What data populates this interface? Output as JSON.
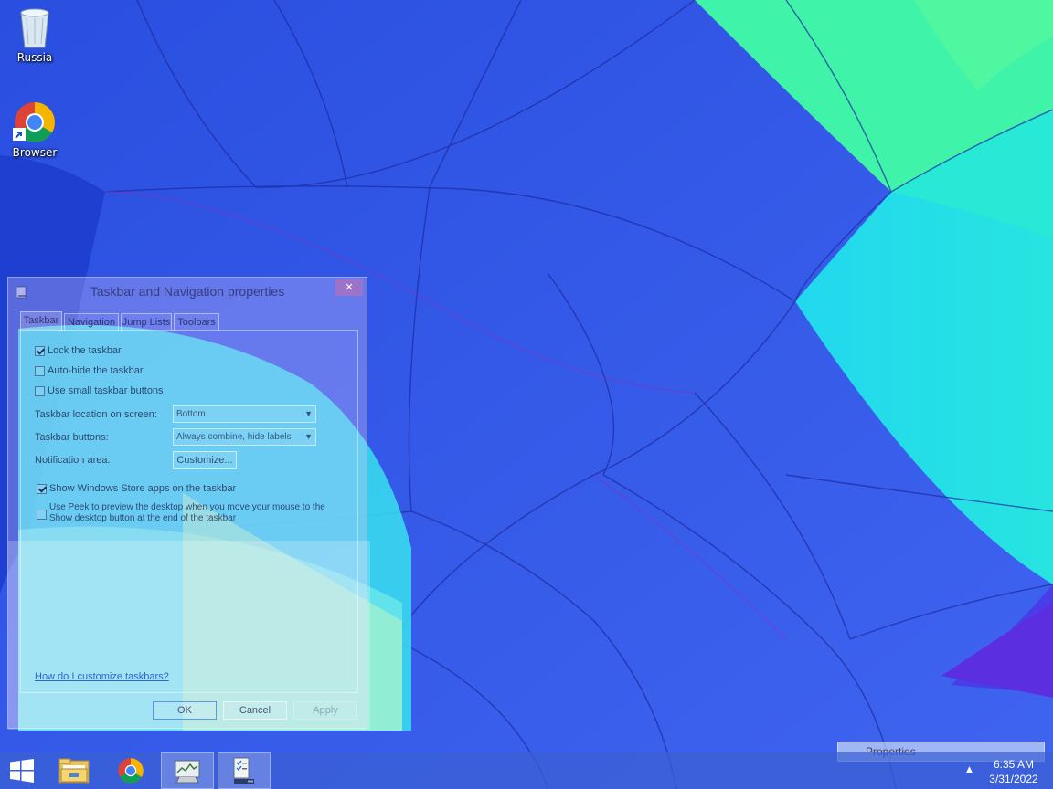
{
  "desktop": {
    "icons": [
      {
        "label": "Russia",
        "icon": "recycle-bin-icon"
      },
      {
        "label": "Browser",
        "icon": "chrome-icon"
      }
    ]
  },
  "dialog": {
    "title": "Taskbar and Navigation properties",
    "close_glyph": "✕",
    "tabs": [
      {
        "label": "Taskbar",
        "active": true
      },
      {
        "label": "Navigation",
        "active": false
      },
      {
        "label": "Jump Lists",
        "active": false
      },
      {
        "label": "Toolbars",
        "active": false
      }
    ],
    "options": {
      "lock_taskbar": {
        "label": "Lock the taskbar",
        "checked": true
      },
      "auto_hide": {
        "label": "Auto-hide the taskbar",
        "checked": false
      },
      "small_buttons": {
        "label": "Use small taskbar buttons",
        "checked": false
      },
      "location_label": "Taskbar location on screen:",
      "location_value": "Bottom",
      "buttons_label": "Taskbar buttons:",
      "buttons_value": "Always combine, hide labels",
      "notification_label": "Notification area:",
      "customize_button": "Customize...",
      "store_apps": {
        "label": "Show Windows Store apps on the taskbar",
        "checked": true
      },
      "peek": {
        "label_line1": "Use Peek to preview the desktop when you move your mouse to the",
        "label_line2": "Show desktop button at the end of the taskbar",
        "checked": false
      }
    },
    "help_link": "How do I customize taskbars?",
    "buttons": {
      "ok": "OK",
      "cancel": "Cancel",
      "apply": "Apply"
    }
  },
  "taskbar": {
    "items": [
      {
        "name": "start-button",
        "icon": "windows-logo-icon"
      },
      {
        "name": "file-explorer",
        "icon": "folder-icon"
      },
      {
        "name": "chrome",
        "icon": "chrome-icon"
      },
      {
        "name": "system-monitor",
        "icon": "monitor-chart-icon"
      },
      {
        "name": "properties-window",
        "icon": "taskbar-properties-icon"
      }
    ],
    "tooltip": "Properties",
    "tray_arrow": "▲",
    "time": "6:35 AM",
    "date": "3/31/2022"
  },
  "colors": {
    "wallpaper_blue": "#2f58e6",
    "wallpaper_cyan": "#19e6e6",
    "wallpaper_green": "#3df5a8",
    "accent": "#1a50c8"
  }
}
